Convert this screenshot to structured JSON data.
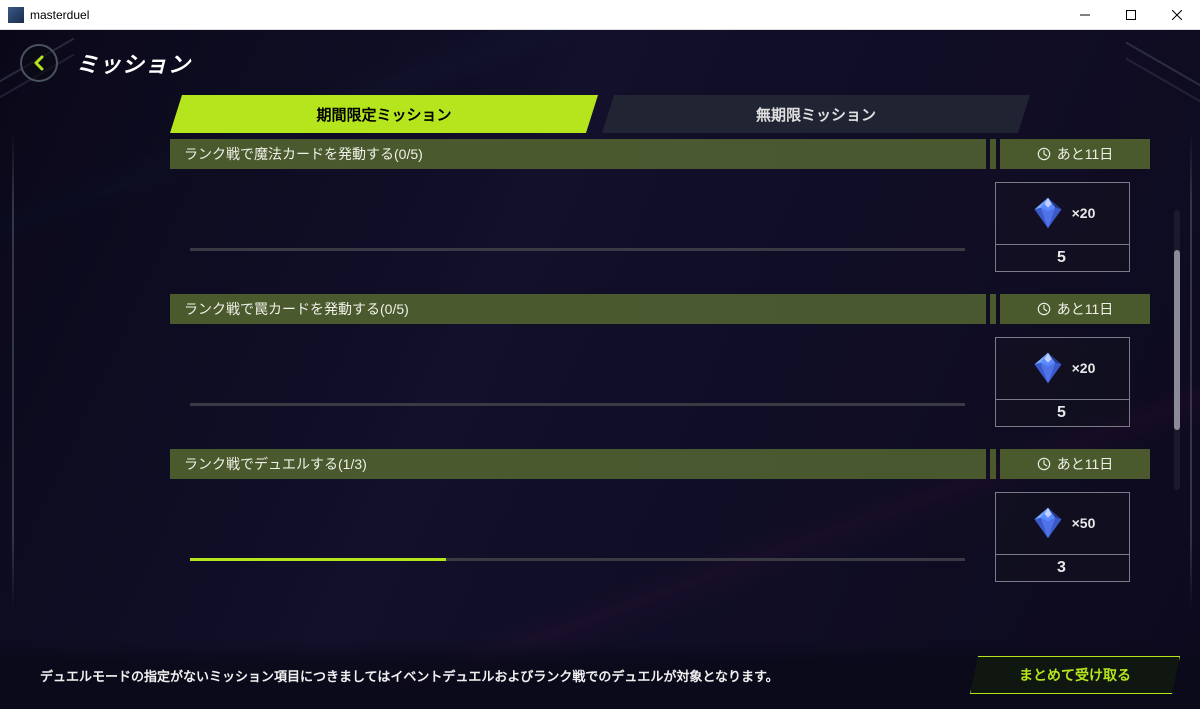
{
  "window": {
    "title": "masterduel"
  },
  "page": {
    "title": "ミッション"
  },
  "tabs": [
    {
      "label": "期間限定ミッション",
      "active": true
    },
    {
      "label": "無期限ミッション",
      "active": false
    }
  ],
  "missions": [
    {
      "title": "ランク戦で魔法カードを発動する(0/5)",
      "time_left": "あと11日",
      "progress_pct": 0,
      "reward_qty": "×20",
      "reward_target": "5"
    },
    {
      "title": "ランク戦で罠カードを発動する(0/5)",
      "time_left": "あと11日",
      "progress_pct": 0,
      "reward_qty": "×20",
      "reward_target": "5"
    },
    {
      "title": "ランク戦でデュエルする(1/3)",
      "time_left": "あと11日",
      "progress_pct": 33,
      "reward_qty": "×50",
      "reward_target": "3"
    }
  ],
  "footer": {
    "note": "デュエルモードの指定がないミッション項目につきましてはイベントデュエルおよびランク戦でのデュエルが対象となります。",
    "collect_all": "まとめて受け取る"
  },
  "colors": {
    "accent": "#b5e61d"
  }
}
